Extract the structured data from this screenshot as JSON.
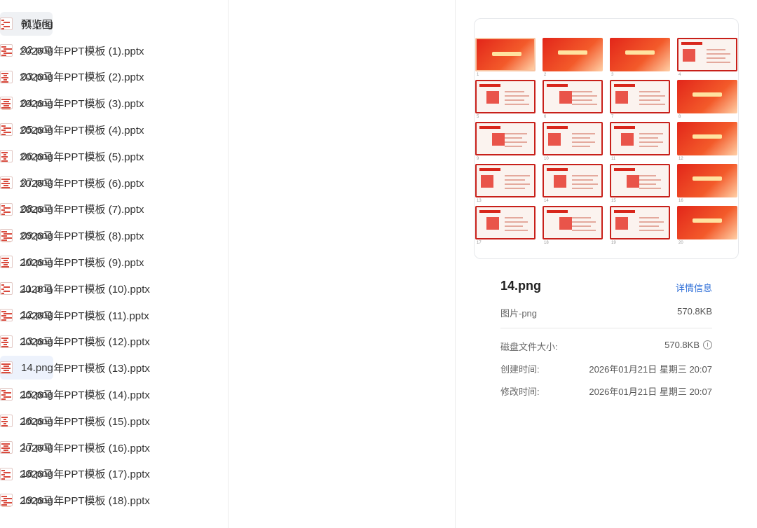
{
  "folders": {
    "selected_label": "预览图",
    "pptx_files": [
      "2026马年PPT模板 (1).pptx",
      "2026马年PPT模板 (2).pptx",
      "2026马年PPT模板 (3).pptx",
      "2026马年PPT模板 (4).pptx",
      "2026马年PPT模板 (5).pptx",
      "2026马年PPT模板 (6).pptx",
      "2026马年PPT模板 (7).pptx",
      "2026马年PPT模板 (8).pptx",
      "2026马年PPT模板 (9).pptx",
      "2026马年PPT模板 (10).pptx",
      "2026马年PPT模板 (11).pptx",
      "2026马年PPT模板 (12).pptx",
      "2026马年PPT模板 (13).pptx",
      "2026马年PPT模板 (14).pptx",
      "2026马年PPT模板 (15).pptx",
      "2026马年PPT模板 (16).pptx",
      "2026马年PPT模板 (17).pptx",
      "2026马年PPT模板 (18).pptx"
    ]
  },
  "images": {
    "files": [
      "01.png",
      "02.png",
      "03.png",
      "04.png",
      "05.png",
      "06.png",
      "07.png",
      "08.png",
      "09.png",
      "10.png",
      "11.png",
      "12.png",
      "13.png",
      "14.png",
      "15.png",
      "16.png",
      "17.png",
      "18.png",
      "19.png"
    ],
    "selected_index": 13
  },
  "preview": {
    "file_name": "14.png",
    "details_link": "详情信息",
    "file_type": "图片-png",
    "file_size": "570.8KB",
    "disk_size_label": "磁盘文件大小:",
    "disk_size_value": "570.8KB",
    "created_label": "创建时间:",
    "created_value": "2026年01月21日 星期三 20:07",
    "modified_label": "修改时间:",
    "modified_value": "2026年01月21日 星期三 20:07",
    "thumbnail_numbers": [
      "1",
      "2",
      "3",
      "4",
      "5",
      "6",
      "7",
      "8",
      "9",
      "10",
      "11",
      "12",
      "13",
      "14",
      "15",
      "16",
      "17",
      "18",
      "19",
      "20"
    ]
  },
  "colors": {
    "accent_link": "#2f6fd8",
    "selected_row_col1": "#eff1f4",
    "selected_row_col2": "#edf2fc",
    "slide_red": "#e2261a"
  }
}
